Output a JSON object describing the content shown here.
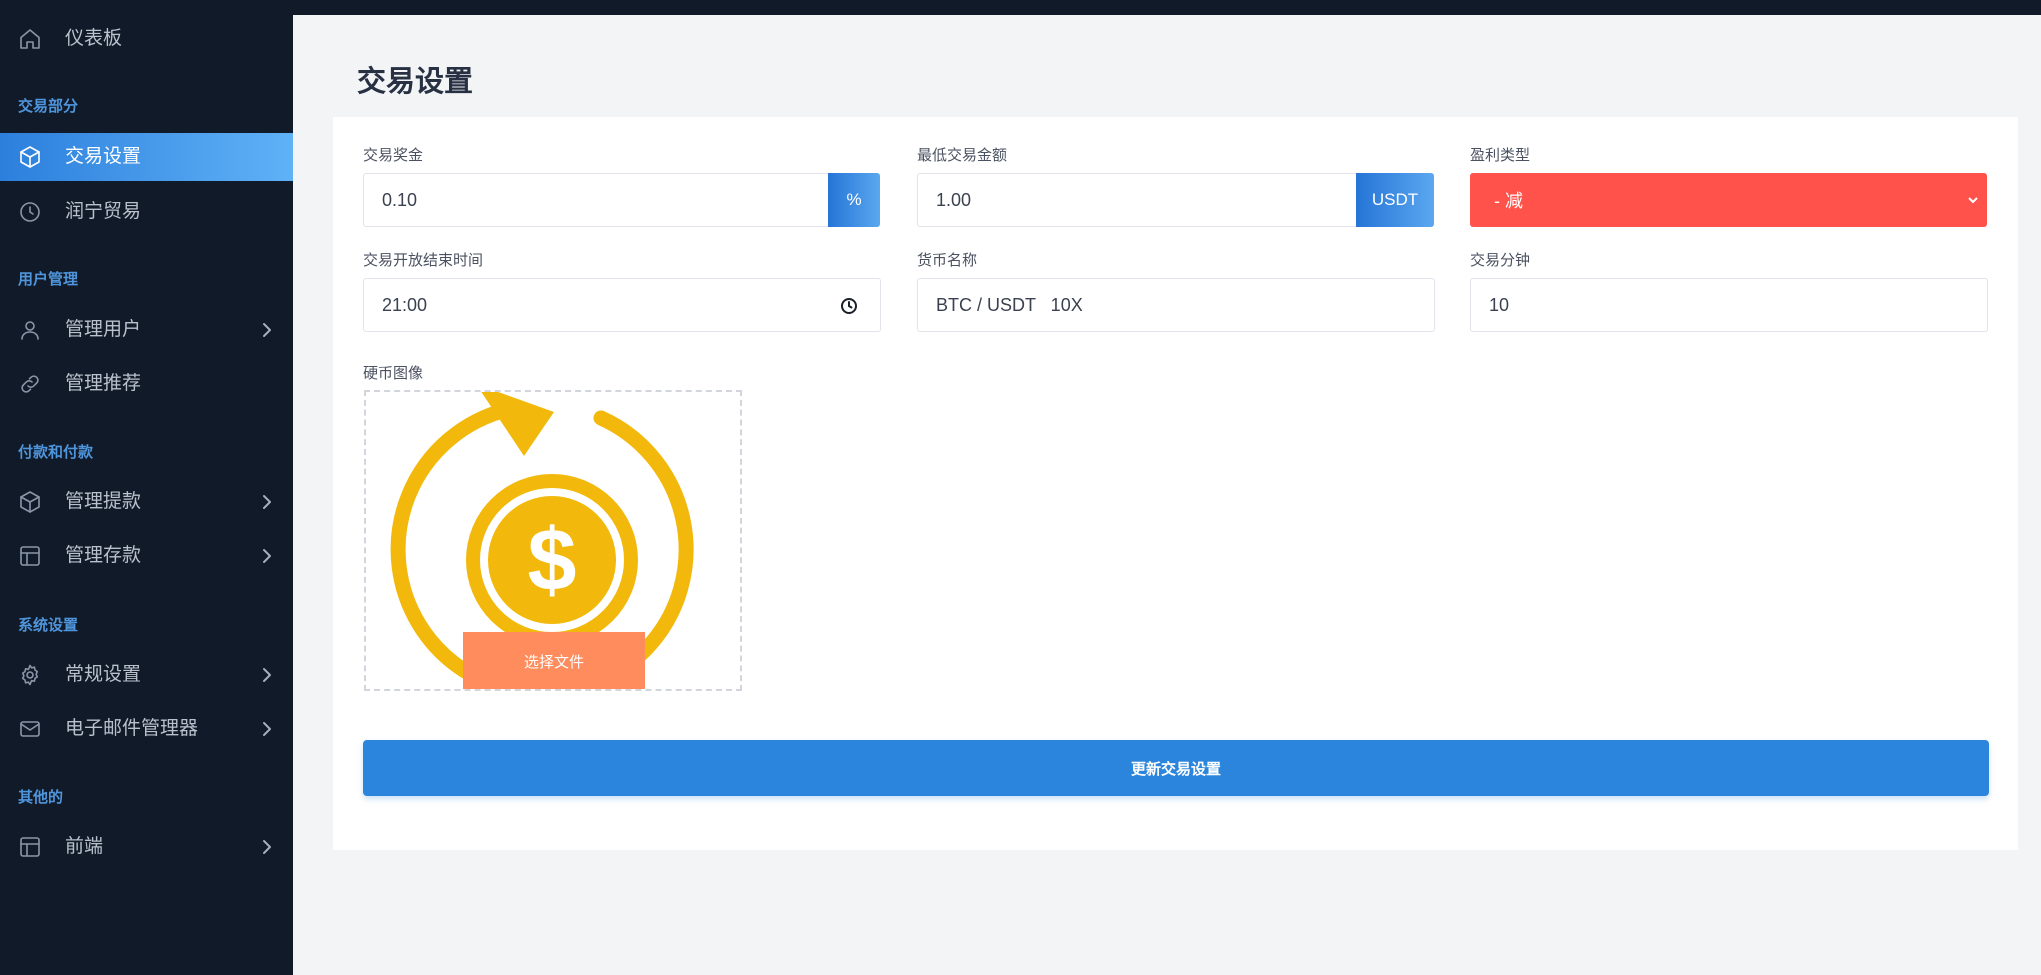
{
  "sidebar": {
    "items": [
      {
        "label": "仪表板",
        "icon": "home-icon"
      },
      {
        "label": "交易设置",
        "icon": "cube-icon",
        "active": true
      },
      {
        "label": "润宁贸易",
        "icon": "clock-icon"
      },
      {
        "label": "管理用户",
        "icon": "user-icon"
      },
      {
        "label": "管理推荐",
        "icon": "link-icon"
      },
      {
        "label": "管理提款",
        "icon": "cube-icon"
      },
      {
        "label": "管理存款",
        "icon": "table-icon"
      },
      {
        "label": "常规设置",
        "icon": "gear-icon"
      },
      {
        "label": "电子邮件管理器",
        "icon": "mail-icon"
      },
      {
        "label": "前端",
        "icon": "table-icon"
      }
    ],
    "sections": [
      "交易部分",
      "用户管理",
      "付款和付款",
      "系统设置",
      "其他的"
    ]
  },
  "page": {
    "title": "交易设置"
  },
  "form": {
    "trade_bonus": {
      "label": "交易奖金",
      "value": "0.10",
      "unit": "%"
    },
    "min_amount": {
      "label": "最低交易金额",
      "value": "1.00",
      "unit": "USDT"
    },
    "profit_type": {
      "label": "盈利类型",
      "value": "- 减"
    },
    "open_close_time": {
      "label": "交易开放结束时间",
      "value": "21:00"
    },
    "currency_name": {
      "label": "货币名称",
      "value": "BTC / USDT   10X"
    },
    "trade_minutes": {
      "label": "交易分钟",
      "value": "10"
    },
    "coin_image": {
      "label": "硬币图像",
      "button": "选择文件"
    },
    "submit": "更新交易设置"
  },
  "colors": {
    "sidebar_bg": "#111a28",
    "accent": "#2b85dc",
    "danger": "#ff524b",
    "upload_btn": "#ff8c5c",
    "coin": "#f2b90c"
  }
}
